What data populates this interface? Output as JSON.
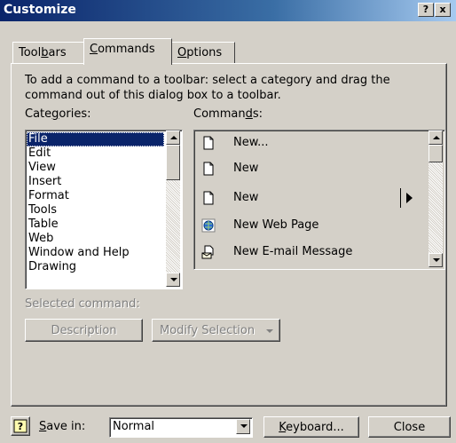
{
  "window": {
    "title": "Customize",
    "help_label": "?",
    "close_label": "x"
  },
  "tabs": [
    {
      "label_pre": "Tool",
      "label_key": "b",
      "label_post": "ars"
    },
    {
      "label_pre": "",
      "label_key": "C",
      "label_post": "ommands"
    },
    {
      "label_pre": "",
      "label_key": "O",
      "label_post": "ptions"
    }
  ],
  "instructions": {
    "line1": "To add a command to a toolbar: select a category and drag the",
    "line2": "command out of this dialog box to a toolbar."
  },
  "categories": {
    "label_pre": "Cate",
    "label_key": "g",
    "label_post": "ories:",
    "items": [
      "File",
      "Edit",
      "View",
      "Insert",
      "Format",
      "Tools",
      "Table",
      "Web",
      "Window and Help",
      "Drawing"
    ]
  },
  "commands": {
    "label_pre": "Comman",
    "label_key": "d",
    "label_post": "s:",
    "items": [
      {
        "label": "New...",
        "icon": "blank-document-icon"
      },
      {
        "label": "New",
        "icon": "blank-document-icon"
      },
      {
        "label": "New",
        "icon": "blank-document-icon"
      },
      {
        "label": "New Web Page",
        "icon": "web-page-icon"
      },
      {
        "label": "New E-mail Message",
        "icon": "email-message-icon"
      }
    ]
  },
  "selected_command": {
    "label": "Selected command:",
    "description_button": "Description",
    "modify_button": "Modify Selection"
  },
  "footer": {
    "save_in_pre": "",
    "save_in_key": "S",
    "save_in_post": "ave in:",
    "save_in_value": "Normal",
    "keyboard_pre": "",
    "keyboard_key": "K",
    "keyboard_post": "eyboard...",
    "close_label": "Close"
  },
  "colors": {
    "titlebar": "#0a246a",
    "face": "#d4d0c8",
    "selection": "#0a246a"
  }
}
